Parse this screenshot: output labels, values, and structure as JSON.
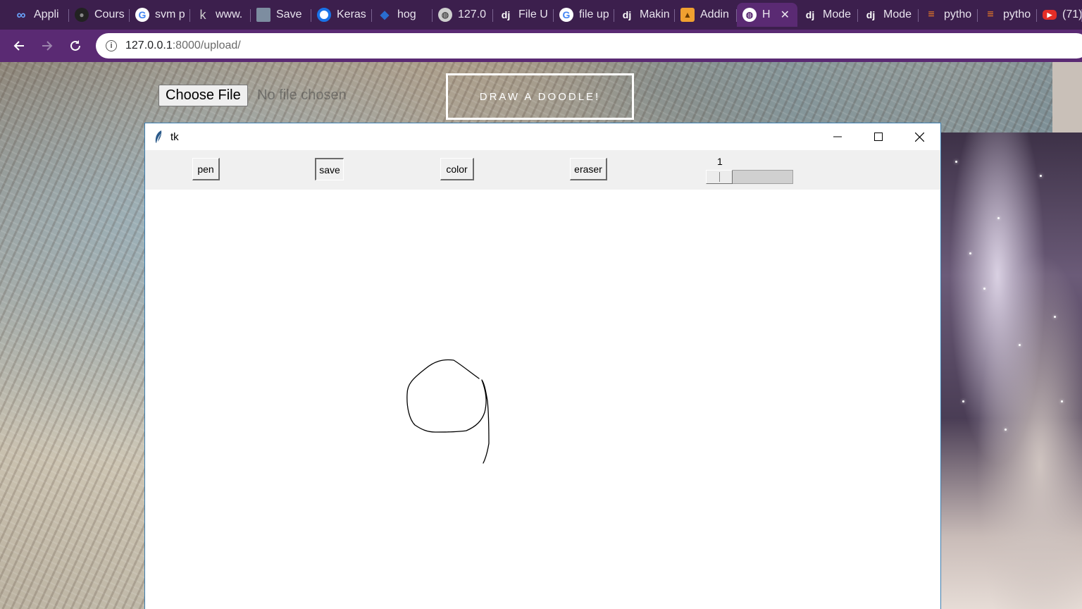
{
  "browser": {
    "tabs": [
      {
        "label": "Appli",
        "icon": "infinity-icon"
      },
      {
        "label": "Cours",
        "icon": "github-icon"
      },
      {
        "label": "svm p",
        "icon": "google-icon"
      },
      {
        "label": "www.",
        "icon": "k-icon"
      },
      {
        "label": "Save",
        "icon": "save-icon"
      },
      {
        "label": "Keras",
        "icon": "keras-icon"
      },
      {
        "label": "hog",
        "icon": "hog-icon"
      },
      {
        "label": "127.0",
        "icon": "globe-icon"
      },
      {
        "label": "File U",
        "icon": "django-icon"
      },
      {
        "label": "file up",
        "icon": "google-icon"
      },
      {
        "label": "Makin",
        "icon": "django-icon"
      },
      {
        "label": "Addin",
        "icon": "fox-icon"
      },
      {
        "label": "H",
        "icon": "globe-icon",
        "active": true
      },
      {
        "label": "Mode",
        "icon": "django-icon"
      },
      {
        "label": "Mode",
        "icon": "django-icon"
      },
      {
        "label": "pytho",
        "icon": "stackoverflow-icon"
      },
      {
        "label": "pytho",
        "icon": "stackoverflow-icon"
      },
      {
        "label": "(71)",
        "icon": "youtube-icon"
      }
    ],
    "address": {
      "host": "127.0.0.1",
      "rest": ":8000/upload/"
    }
  },
  "page": {
    "choose_file_label": "Choose File",
    "no_file_text": "No file chosen",
    "doodle_button": "DRAW A DOODLE!"
  },
  "tk": {
    "title": "tk",
    "buttons": {
      "pen": "pen",
      "save": "save",
      "color": "color",
      "eraser": "eraser"
    },
    "scale_value": "1",
    "scale_fraction": 0.0
  }
}
